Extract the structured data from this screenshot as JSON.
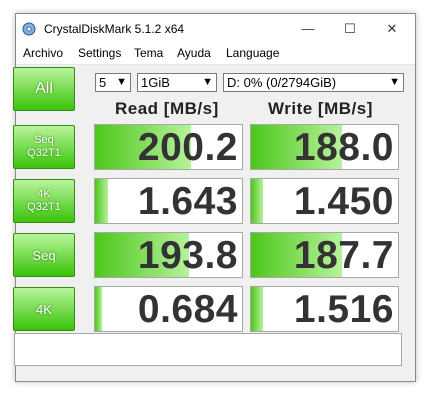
{
  "window": {
    "title": "CrystalDiskMark 5.1.2 x64",
    "controls": {
      "minimize": "—",
      "maximize": "☐",
      "close": "✕"
    }
  },
  "menu": [
    "Archivo",
    "Settings",
    "Tema",
    "Ayuda",
    "Language"
  ],
  "controls": {
    "all_label": "All",
    "count": "5",
    "size": "1GiB",
    "drive": "D: 0% (0/2794GiB)"
  },
  "headers": {
    "read": "Read [MB/s]",
    "write": "Write [MB/s]"
  },
  "rows": [
    {
      "label_line1": "Seq",
      "label_line2": "Q32T1",
      "read": "200.2",
      "write": "188.0",
      "read_level": 0.65,
      "write_level": 0.62
    },
    {
      "label_line1": "4K",
      "label_line2": "Q32T1",
      "read": "1.643",
      "write": "1.450",
      "read_level": 0.09,
      "write_level": 0.08
    },
    {
      "label_line1": "Seq",
      "label_line2": "",
      "read": "193.8",
      "write": "187.7",
      "read_level": 0.64,
      "write_level": 0.62
    },
    {
      "label_line1": "4K",
      "label_line2": "",
      "read": "0.684",
      "write": "1.516",
      "read_level": 0.05,
      "write_level": 0.08
    }
  ],
  "status": "",
  "colors": {
    "accent_green": "#39c309",
    "value_text": "#333333"
  }
}
